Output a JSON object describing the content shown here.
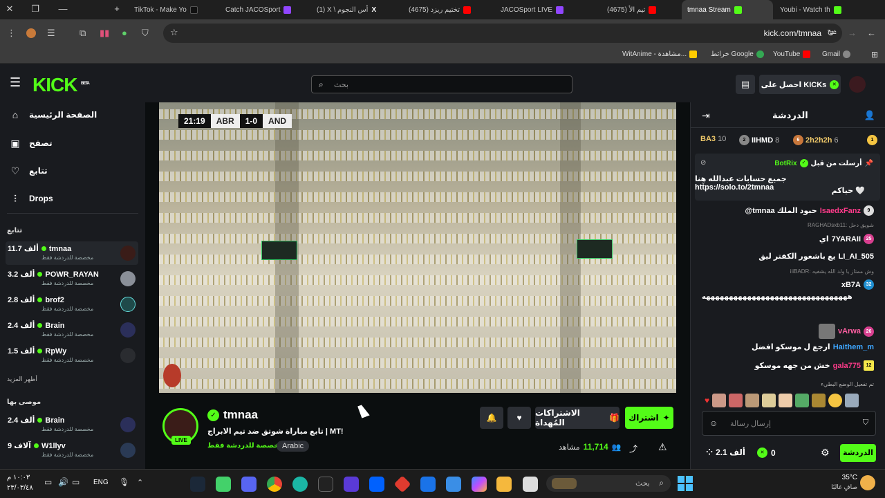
{
  "browser": {
    "tabs": [
      {
        "title": "TikTok - Make Yo",
        "color": "#111111"
      },
      {
        "title": "Catch JACOSport",
        "color": "#9146ff"
      },
      {
        "title": "(1) X \\ أس النجوم",
        "color": "#000000"
      },
      {
        "title": "(4675) تختيم ريزد",
        "color": "#ff0000"
      },
      {
        "title": "JACOSport LIVE",
        "color": "#9146ff"
      },
      {
        "title": "(4675) تيم الأ",
        "color": "#ff0000"
      },
      {
        "title": "tmnaa Stream",
        "color": "#53fc18"
      },
      {
        "title": "Youbi - Watch th",
        "color": "#53fc18"
      }
    ],
    "address": "kick.com/tmnaa",
    "bookmarks": [
      "WitAnime - مشاهدة...",
      "خرائط Google",
      "YouTube",
      "Gmail"
    ]
  },
  "kick": {
    "logo": "KICK",
    "logo_beta": "BETA",
    "search_placeholder": "بحث",
    "get_kicks": "احصل على KICKs"
  },
  "sidebar": {
    "nav": [
      {
        "label": "الصفحة الرئيسية",
        "icon": "home-icon"
      },
      {
        "label": "تصفح",
        "icon": "browse-icon"
      },
      {
        "label": "تتابع",
        "icon": "heart-icon"
      },
      {
        "label": "Drops",
        "icon": "drops-icon"
      }
    ],
    "following_title": "تتابع",
    "following": [
      {
        "name": "tmnaa",
        "viewers": "11.7 ألف",
        "sub": "مخصصة للدردشة فقط"
      },
      {
        "name": "POWR_RAYAN",
        "viewers": "3.2 ألف",
        "sub": "مخصصة للدردشة فقط"
      },
      {
        "name": "brof2",
        "viewers": "2.8 ألف",
        "sub": "مخصصة للدردشة فقط"
      },
      {
        "name": "Brain",
        "viewers": "2.4 ألف",
        "sub": "مخصصة للدردشة فقط"
      },
      {
        "name": "RpWy",
        "viewers": "1.5 ألف",
        "sub": "مخصصة للدردشة فقط"
      }
    ],
    "show_more": "أظهر المزيد",
    "recommended_title": "موصى بها",
    "recommended": [
      {
        "name": "Brain",
        "viewers": "2.4 ألف",
        "sub": "مخصصة للدردشة فقط"
      },
      {
        "name": "W1llyv",
        "viewers": "9 آلاف",
        "sub": "مخصصة للدردشة فقط"
      }
    ]
  },
  "video": {
    "score": {
      "home": "ABR",
      "away": "AND",
      "result": "1-0",
      "clock": "21:19"
    }
  },
  "stream": {
    "name": "tmnaa",
    "title": "تابع مباراة شوتق ضد تيم الابراج | MT!",
    "category": "مخصصة للدردشة فقط",
    "tag": "Arabic",
    "live": "LIVE",
    "subscribe": "اشتراك",
    "gift": "الاشتراكات المُهداة",
    "viewers": "11,714",
    "viewers_label": "مشاهد"
  },
  "chat": {
    "title": "الدردشة",
    "leaderboard": [
      {
        "rank": "1",
        "name": "2h2h2h",
        "count": "6"
      },
      {
        "rank": "2",
        "name": "IIHMD",
        "count": "8"
      },
      {
        "rank": "3",
        "name": "BA3",
        "count": "10"
      }
    ],
    "pinned": {
      "by": "أرسلت من قبل",
      "author": "BotRix",
      "line1": "جميع حسابات عبدالله هنا https://solo.to/2tmnaa",
      "line2": "حياكم 🤍"
    },
    "messages": [
      {
        "user": "IsaedxFanz",
        "text": "@tmnaa حبود الملك",
        "color": "#ff3b8a",
        "badge": "9"
      },
      {
        "reply": "RAGHADsxb11: شويق دحل",
        "user": "7YARAII",
        "text": "اي",
        "color": "#ffffff",
        "badge": "25"
      },
      {
        "user": "LI_AI_505",
        "text": "يع باشعور الكفتر ليق",
        "color": "#ffffff"
      },
      {
        "reply": "iiiBADR: وش ممتاز يا ولد الله يشفيه",
        "user": "xB7A",
        "text": "ههههههههههههههههههههههههههههههههه",
        "color": "#ffffff",
        "badge": "32"
      },
      {
        "user": "vArwa",
        "text": "",
        "color": "#ff5fa2",
        "badge": "26"
      },
      {
        "user": "Haithem_m",
        "text": "ارجع ل موسكو افضل",
        "color": "#3ea6ff"
      },
      {
        "user": "gala775",
        "text": "خش من جهه موسكو",
        "color": "#ff3b8a",
        "badge": "12"
      }
    ],
    "slow_mode": "تم تفعيل الوضع البطيء",
    "input_placeholder": "إرسال رسالة",
    "send": "الدردشة",
    "kicks": "0",
    "points": "2.1 ألف"
  },
  "taskbar": {
    "search_placeholder": "بحث",
    "lang": "ENG",
    "time": "١٠:٠٣ م",
    "date": "٢٣/٠٣/٤٨",
    "weather_temp": "35°C",
    "weather_text": "صافٍ غالبًا"
  }
}
